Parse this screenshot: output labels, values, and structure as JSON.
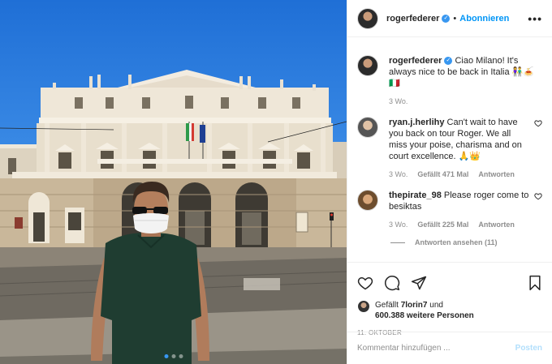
{
  "header": {
    "username": "rogerfederer",
    "follow_label": "Abonnieren",
    "separator": "•",
    "more_icon": "more-horizontal-icon"
  },
  "caption": {
    "username": "rogerfederer",
    "text": "Ciao Milano! It's always nice to be back in Italia 👫🍝",
    "flag_text": "🇮🇹",
    "time": "3 Wo."
  },
  "comments": [
    {
      "username": "ryan.j.herlihy",
      "text": "Can't wait to have you back on tour Roger. We all miss your poise, charisma and on court excellence. 🙏👑",
      "time": "3 Wo.",
      "likes": "Gefällt 471 Mal",
      "reply_label": "Antworten"
    },
    {
      "username": "thepirate_98",
      "text": "Please roger come to besiktas",
      "time": "3 Wo.",
      "likes": "Gefällt 225 Mal",
      "reply_label": "Antworten"
    }
  ],
  "view_replies_label": "Antworten ansehen (11)",
  "likes": {
    "prefix": "Gefällt",
    "first_user": "7lorin7",
    "connector": "und",
    "others": "600.388 weitere Personen"
  },
  "date": "11. OKTOBER",
  "add_comment": {
    "placeholder": "Kommentar hinzufügen ...",
    "post_label": "Posten"
  },
  "colors": {
    "accent": "#0095f6",
    "muted": "#8e8e8e",
    "post_disabled": "#b2dffc"
  }
}
